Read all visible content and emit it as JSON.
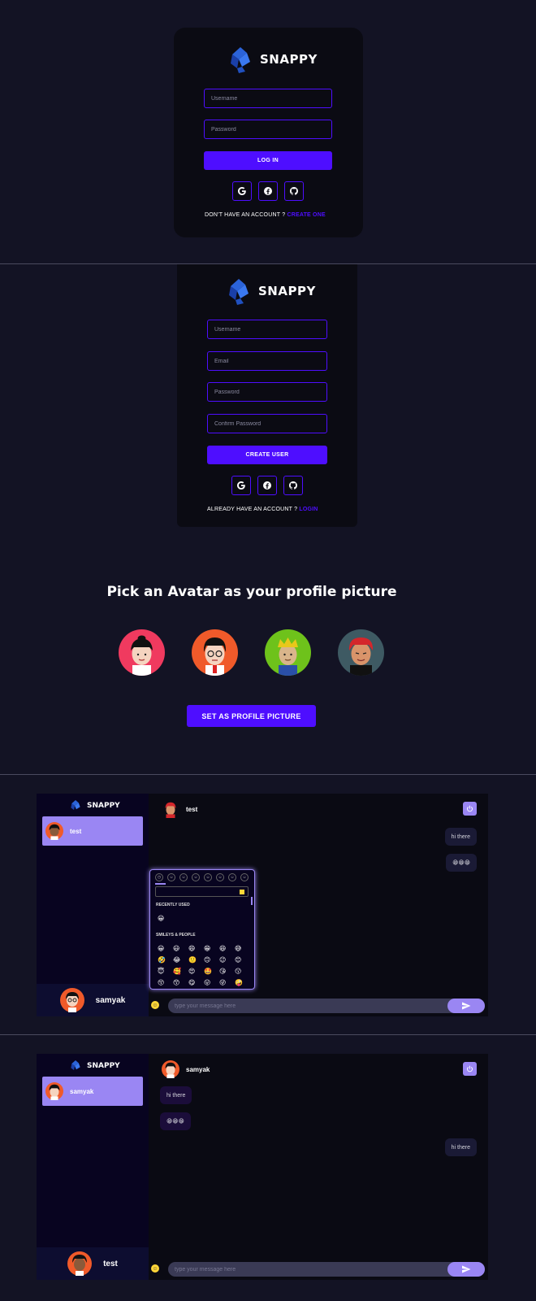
{
  "colors": {
    "bg": "#131324",
    "card": "#0b0b13",
    "accent": "#4e0eff",
    "accent_light": "#9a86f3"
  },
  "login": {
    "brand": "SNAPPY",
    "username_placeholder": "Username",
    "password_placeholder": "Password",
    "submit_label": "LOG IN",
    "social": [
      "google-icon",
      "facebook-icon",
      "github-icon"
    ],
    "switch_text": "DON'T HAVE AN ACCOUNT ?",
    "switch_link": "CREATE ONE"
  },
  "register": {
    "brand": "SNAPPY",
    "username_placeholder": "Username",
    "email_placeholder": "Email",
    "password_placeholder": "Password",
    "confirm_placeholder": "Confirm Password",
    "submit_label": "CREATE USER",
    "social": [
      "google-icon",
      "facebook-icon",
      "github-icon"
    ],
    "switch_text": "ALREADY HAVE AN ACCOUNT ?",
    "switch_link": "LOGIN"
  },
  "avatar_picker": {
    "title": "Pick an Avatar as your profile picture",
    "avatars": [
      {
        "bg": "#f03a5f",
        "hair": "#111"
      },
      {
        "bg": "#f05a2a",
        "hair": "#111"
      },
      {
        "bg": "#6ec21b",
        "hair": "#e8c81a"
      },
      {
        "bg": "#3e5a63",
        "hair": "#d4262b"
      }
    ],
    "button_label": "SET AS PROFILE PICTURE"
  },
  "chat1": {
    "brand": "SNAPPY",
    "contact_name": "test",
    "current_user": "samyak",
    "chat_with": "test",
    "messages": [
      {
        "text": "hi there",
        "dir": "sent"
      },
      {
        "text": "😁😁😁",
        "dir": "sent"
      }
    ],
    "input_placeholder": "type your message here",
    "emoji_picker": {
      "section_recent": "RECENTLY USED",
      "section_smileys": "SMILEYS & PEOPLE",
      "recent": [
        "😀"
      ],
      "grid": [
        "😀",
        "😃",
        "😄",
        "😁",
        "😆",
        "😅",
        "🤣",
        "😂",
        "🙂",
        "🙃",
        "😉",
        "😊",
        "😇",
        "🥰",
        "😍",
        "🤩",
        "😘",
        "😗",
        "😚",
        "😙",
        "😋",
        "😛",
        "😜",
        "🤪"
      ]
    }
  },
  "chat2": {
    "brand": "SNAPPY",
    "contact_name": "samyak",
    "current_user": "test",
    "chat_with": "samyak",
    "messages": [
      {
        "text": "hi there",
        "dir": "recv"
      },
      {
        "text": "😁😁😁",
        "dir": "recv"
      },
      {
        "text": "hi there",
        "dir": "sent"
      }
    ],
    "input_placeholder": "type your message here"
  }
}
